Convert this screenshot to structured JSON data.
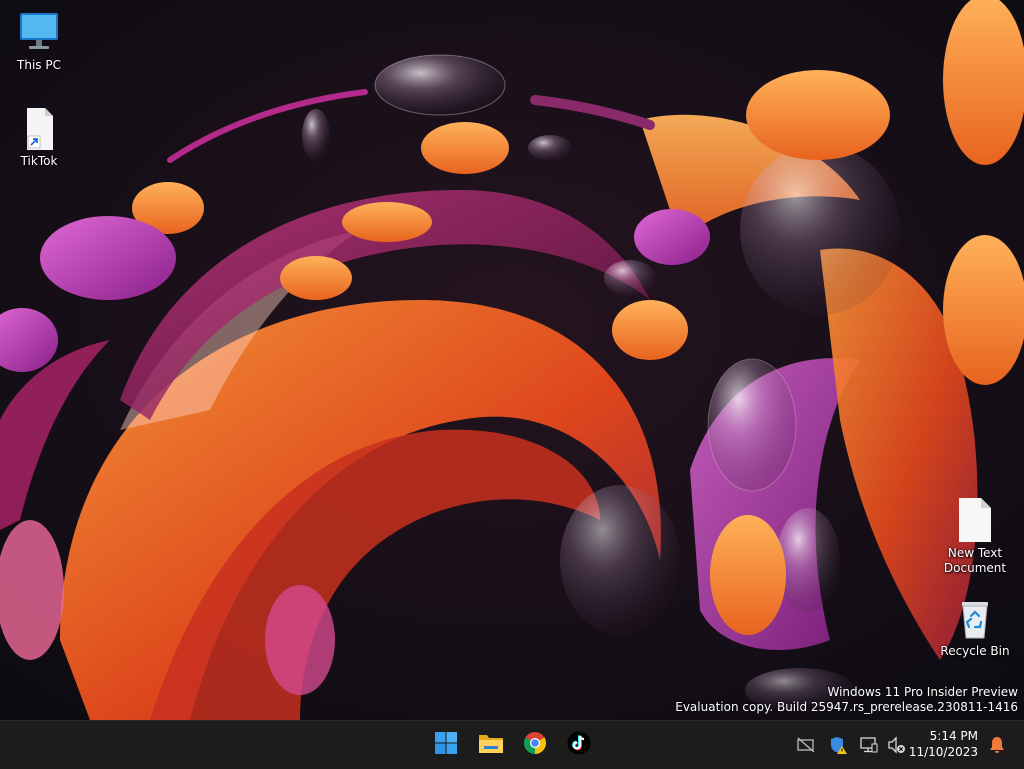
{
  "desktop": {
    "icons": [
      {
        "label": "This PC",
        "icon": "monitor-icon"
      },
      {
        "label": "TikTok",
        "icon": "shortcut-file-icon"
      },
      {
        "label": "New Text",
        "label2": "Document",
        "icon": "text-file-icon"
      },
      {
        "label": "Recycle Bin",
        "icon": "recycle-bin-icon"
      }
    ],
    "watermark": {
      "line1": "Windows 11 Pro Insider Preview",
      "line2": "Evaluation copy. Build 25947.rs_prerelease.230811-1416"
    }
  },
  "taskbar": {
    "apps": [
      {
        "name": "Start",
        "icon": "windows-logo-icon"
      },
      {
        "name": "File Explorer",
        "icon": "folder-icon"
      },
      {
        "name": "Google Chrome",
        "icon": "chrome-icon"
      },
      {
        "name": "TikTok",
        "icon": "tiktok-icon"
      }
    ],
    "tray": [
      "network-disconnected-icon",
      "security-warning-icon",
      "display-icon",
      "volume-muted-icon"
    ],
    "clock": {
      "time": "5:14 PM",
      "date": "11/10/2023"
    },
    "notification_icon": "bell-icon"
  },
  "colors": {
    "taskbar_bg": "#1c1c1c",
    "wallpaper_bg": "#120d14",
    "accent_blue": "#3aa0f0",
    "notification_orange": "#f07a3a"
  }
}
